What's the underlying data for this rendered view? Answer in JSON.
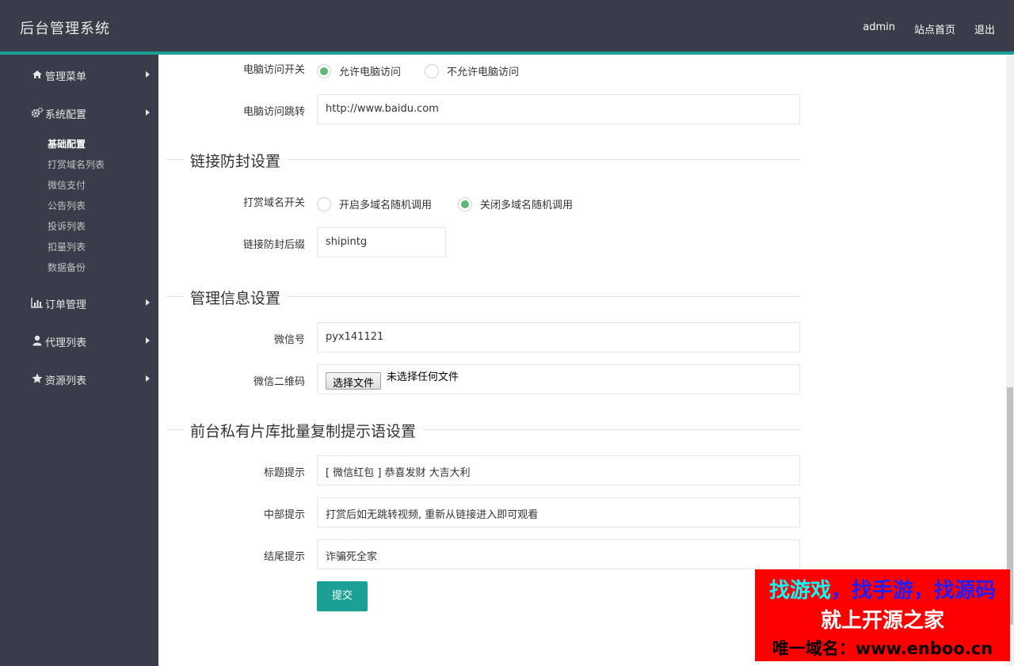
{
  "header": {
    "brand": "后台管理系统",
    "nav": [
      "admin",
      "站点首页",
      "退出"
    ]
  },
  "sidebar": {
    "menus": [
      {
        "label": "管理菜单",
        "icon": "home-icon"
      },
      {
        "label": "系统配置",
        "icon": "gears-icon"
      },
      {
        "label": "订单管理",
        "icon": "bar-chart-icon"
      },
      {
        "label": "代理列表",
        "icon": "user-icon"
      },
      {
        "label": "资源列表",
        "icon": "star-icon"
      }
    ],
    "submenu": [
      "基础配置",
      "打赏域名列表",
      "微信支付",
      "公告列表",
      "投诉列表",
      "扣量列表",
      "数据备份"
    ]
  },
  "form": {
    "pc_switch_label": "电脑访问开关",
    "pc_allow": "允许电脑访问",
    "pc_deny": "不允许电脑访问",
    "pc_redirect_label": "电脑访问跳转",
    "pc_redirect_value": "http://www.baidu.com",
    "section_link": "链接防封设置",
    "domain_switch_label": "打赏域名开关",
    "domain_on": "开启多域名随机调用",
    "domain_off": "关闭多域名随机调用",
    "suffix_label": "链接防封后缀",
    "suffix_value": "shipintg",
    "section_admin": "管理信息设置",
    "wechat_label": "微信号",
    "wechat_value": "pyx141121",
    "qrcode_label": "微信二维码",
    "file_button": "选择文件",
    "file_status": "未选择任何文件",
    "section_tips": "前台私有片库批量复制提示语设置",
    "title_tip_label": "标题提示",
    "title_tip_value": "[ 微信红包 ] 恭喜发财 大吉大利",
    "middle_tip_label": "中部提示",
    "middle_tip_value": "打赏后如无跳转视频, 重新从链接进入即可观看",
    "end_tip_label": "结尾提示",
    "end_tip_value": "诈骗死全家",
    "submit": "提交"
  },
  "ad": {
    "line1_a": "找游戏",
    "line1_b": "，找手游，找源码",
    "line2": "就上开源之家",
    "line3": "唯一域名：www.enboo.cn"
  },
  "colors": {
    "header_bg": "#393d49",
    "accent": "#1aa094",
    "radio_checked": "#5fb878"
  }
}
